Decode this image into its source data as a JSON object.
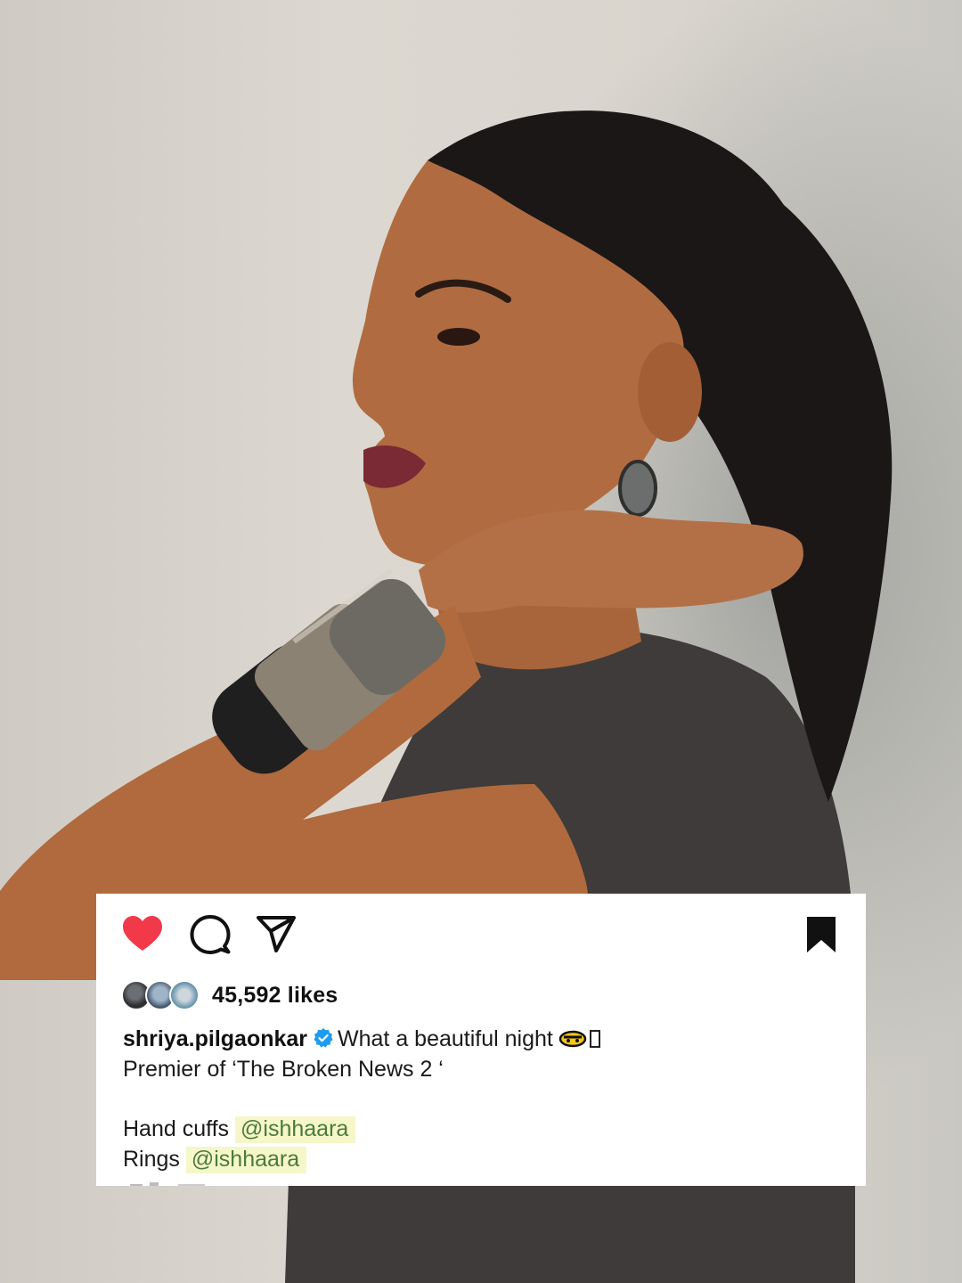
{
  "post": {
    "likes": "45,592 likes",
    "username": "shriya.pilgaonkar",
    "caption_lines": [
      "What a beautiful night",
      "Premier of ‘The Broken News 2 ‘",
      "",
      "Hand cuffs",
      "Rings"
    ],
    "mention_1": "@ishhaara",
    "mention_2": "@ishhaara",
    "liked": true,
    "saved": true
  },
  "icons": {
    "like": "heart-filled-icon",
    "comment": "comment-bubble-icon",
    "share": "paper-plane-icon",
    "save": "bookmark-filled-icon",
    "verified": "verified-badge-icon",
    "emoji": "emoji-icon"
  },
  "colors": {
    "heart": "#f2394a",
    "verified": "#1d9bf0",
    "mention_text": "#4a7a3e",
    "mention_highlight": "#f6f7c9",
    "card_bg": "#ffffff"
  }
}
